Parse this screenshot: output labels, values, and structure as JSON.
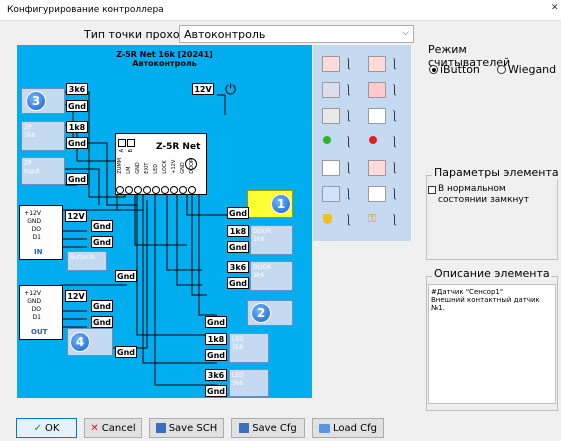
{
  "window": {
    "title": "Конфигурирование контроллера",
    "close": "✕"
  },
  "access_point": {
    "label": "Тип точки прохода",
    "selected": "Автоконтроль"
  },
  "diagram": {
    "title": "Z-5R Net 16k [20241]",
    "subtitle": "Автоконтроль",
    "controller_name": "Z-5R Net",
    "power": "12V",
    "controller_pins": [
      "ZUMM",
      "LM",
      "GND",
      "EXIT",
      "LED",
      "LOCK",
      "+12V",
      "GND",
      "DOOR"
    ],
    "controller_top_pins": [
      "A",
      "B"
    ],
    "left_blocks": [
      {
        "num": "3",
        "top": "3k6",
        "bottom": "Gnd"
      },
      {
        "res": "1k8",
        "texts": [
          "ZP",
          "1k8"
        ],
        "gnd": "Gnd"
      },
      {
        "texts": [
          "ZP",
          "Input"
        ],
        "gnd": "Gnd"
      }
    ],
    "reader_in": {
      "pins": [
        "+12V",
        "GND",
        "DO",
        "D1"
      ],
      "label": "IN",
      "v": "12V",
      "gnd1": "Gnd",
      "gnd2": "Gnd"
    },
    "button_in": {
      "text": "ButtonIn",
      "gnd": "Gnd"
    },
    "reader_out": {
      "pins": [
        "+12V",
        "GND",
        "DO",
        "D1"
      ],
      "label": "OUT",
      "v": "12V",
      "gnd1": "Gnd",
      "gnd2": "Gnd"
    },
    "block4": {
      "num": "4",
      "gnd": "Gnd"
    },
    "right_block1": {
      "num": "1",
      "gnd": "Gnd",
      "r1": "1k8",
      "t1": [
        "DOOR",
        "1k8"
      ],
      "r2": "3k6",
      "t2": [
        "DOOR",
        "3k6"
      ],
      "gnd2": "Gnd",
      "gnd3": "Gnd"
    },
    "right_block2": {
      "num": "2",
      "gnd": "Gnd",
      "r1": "1k8",
      "t1": [
        "LED",
        "1k8"
      ],
      "r2": "3k6",
      "t2": [
        "LED",
        "3k6"
      ],
      "gnd2": "Gnd",
      "gnd3": "Gnd"
    }
  },
  "reader_mode": {
    "label": "Режим считывателей",
    "options": [
      "iButton",
      "Wiegand"
    ],
    "selected": "iButton"
  },
  "element_params": {
    "label": "Параметры элемента",
    "checkbox": "В нормальном состоянии замкнут",
    "checked": false
  },
  "element_desc": {
    "label": "Описание элемента",
    "text_line1": "#Датчик \"Сенсор1\"",
    "text_line2": "Внешний контактный датчик",
    "text_line3": "№1."
  },
  "buttons": {
    "ok": "OK",
    "cancel": "Cancel",
    "save_sch": "Save SCH",
    "save_cfg": "Save Cfg",
    "load_cfg": "Load Cfg"
  },
  "icons": [
    "exit-run-icon",
    "no-exit-icon",
    "card-reader-icon",
    "alarm-icon",
    "eye-sensor-icon",
    "door-icon",
    "led-green-icon",
    "led-red-icon",
    "speaker-icon",
    "siren-icon",
    "person-icon",
    "lock-icon",
    "shield-icon",
    "key-icon"
  ]
}
